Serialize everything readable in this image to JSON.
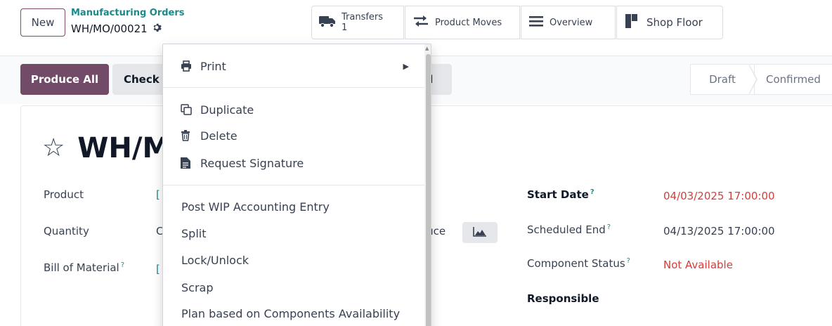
{
  "header": {
    "new_label": "New",
    "breadcrumb_parent": "Manufacturing Orders",
    "breadcrumb_current": "WH/MO/00021"
  },
  "smart_buttons": {
    "transfers_label": "Transfers",
    "transfers_count": "1",
    "product_moves_label": "Product Moves",
    "overview_label": "Overview",
    "shop_floor_label": "Shop Floor"
  },
  "actions": {
    "produce_all": "Produce All",
    "check": "Check",
    "cancel_fragment": "el"
  },
  "stages": {
    "draft": "Draft",
    "confirmed": "Confirmed"
  },
  "form": {
    "title_fragment": "WH/M",
    "product_label": "Product",
    "product_value_fragment": "[",
    "quantity_label": "Quantity",
    "quantity_value_fragment": "C",
    "bom_label": "Bill of Material",
    "bom_value_fragment": "[",
    "produce_fragment": "luce",
    "help_mark": "?",
    "start_date_label": "Start Date",
    "start_date_value": "04/03/2025 17:00:00",
    "scheduled_end_label": "Scheduled End",
    "scheduled_end_value": "04/13/2025 17:00:00",
    "component_status_label": "Component Status",
    "component_status_value": "Not Available",
    "responsible_label": "Responsible"
  },
  "menu": {
    "print": "Print",
    "duplicate": "Duplicate",
    "delete": "Delete",
    "request_signature": "Request Signature",
    "post_wip": "Post WIP Accounting Entry",
    "split": "Split",
    "lock_unlock": "Lock/Unlock",
    "scrap": "Scrap",
    "plan_components": "Plan based on Components Availability"
  },
  "colors": {
    "primary": "#714b67",
    "link": "#1a8a8a",
    "danger": "#d23f3a"
  }
}
